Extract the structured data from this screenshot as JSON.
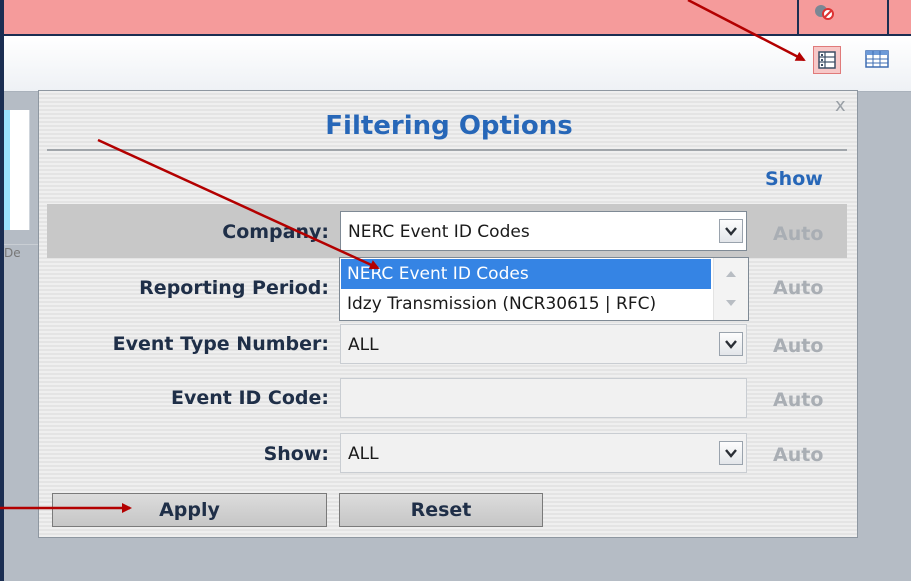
{
  "dialog": {
    "title": "Filtering Options",
    "close_label": "x",
    "show_column_header": "Show",
    "apply_label": "Apply",
    "reset_label": "Reset"
  },
  "background": {
    "left_text": "De"
  },
  "filters": [
    {
      "label": "Company:",
      "value": "NERC Event ID Codes",
      "auto": "Auto"
    },
    {
      "label": "Reporting Period:",
      "value": "",
      "auto": "Auto"
    },
    {
      "label": "Event Type Number:",
      "value": "ALL",
      "auto": "Auto"
    },
    {
      "label": "Event ID Code:",
      "value": "",
      "auto": "Auto"
    },
    {
      "label": "Show:",
      "value": "ALL",
      "auto": "Auto"
    }
  ],
  "company_dropdown_options": [
    {
      "label": "NERC Event ID Codes",
      "selected": true
    },
    {
      "label": "Idzy Transmission (NCR30615 | RFC)",
      "selected": false
    }
  ],
  "icons": {
    "toolbar": [
      "filter-view-icon",
      "grid-view-icon",
      "no-sign-icon",
      "close-icon",
      "dropdown-arrow-icon",
      "scroll-up-icon",
      "scroll-down-icon"
    ],
    "annotation_color": "#b30000"
  },
  "colors": {
    "title_blue": "#2767b8",
    "header_pink": "#f59b9b",
    "selected_option": "#3584e4"
  }
}
